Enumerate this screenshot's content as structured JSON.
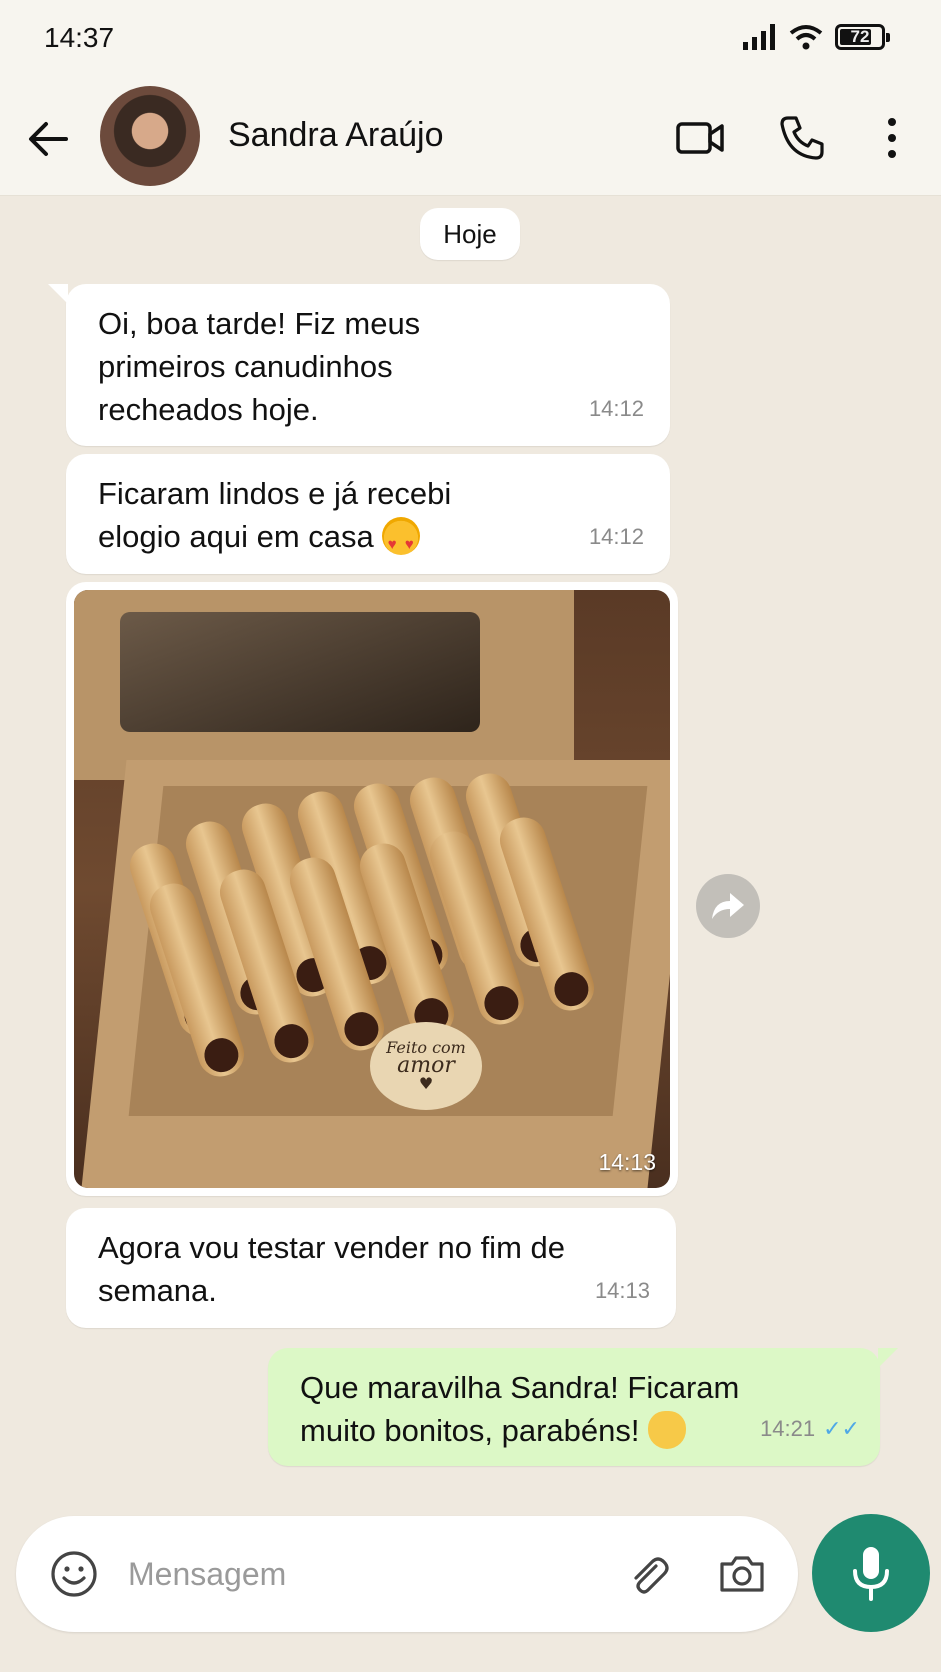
{
  "status_bar": {
    "time": "14:37",
    "battery": "72"
  },
  "header": {
    "contact_name": "Sandra Araújo"
  },
  "chat": {
    "date_label": "Hoje",
    "messages": [
      {
        "text": "Oi, boa tarde! Fiz meus primeiros canudinhos recheados hoje.",
        "time": "14:12"
      },
      {
        "text": "Ficaram lindos e já recebi elogio aqui em casa",
        "time": "14:12"
      },
      {
        "image_seal_line1": "Feito com",
        "image_seal_line2": "amor",
        "time": "14:13"
      },
      {
        "text": "Agora vou testar vender no fim de semana.",
        "time": "14:13"
      },
      {
        "text": "Que maravilha Sandra! Ficaram muito bonitos, parabéns!",
        "time": "14:21",
        "status": "read"
      }
    ]
  },
  "composer": {
    "placeholder": "Mensagem"
  },
  "icons": {
    "back": "arrow-left-icon",
    "video": "video-camera-icon",
    "call": "phone-icon",
    "menu": "more-vertical-icon",
    "emoji": "emoji-icon",
    "attach": "paperclip-icon",
    "camera": "camera-icon",
    "mic": "microphone-icon",
    "forward": "forward-icon"
  },
  "colors": {
    "chat_bg": "#efe9df",
    "outgoing": "#dcf8c6",
    "incoming": "#ffffff",
    "mic_button": "#1f8a70",
    "read_ticks": "#4fa8e6"
  }
}
